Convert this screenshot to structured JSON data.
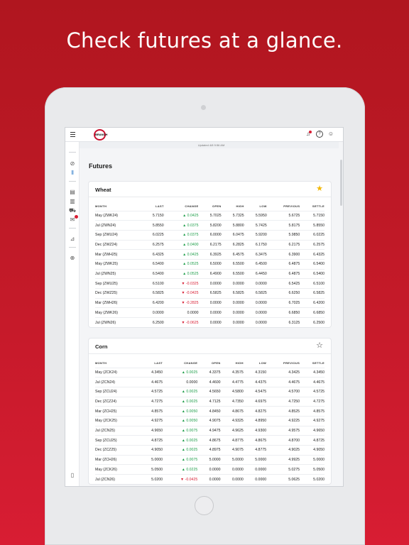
{
  "headline": "Check futures at a glance.",
  "app": {
    "logo_text": "BRANCH",
    "updated_text": "Updated 4/8 9:56 AM",
    "page_title": "Futures"
  },
  "colors": {
    "brand_red": "#c8102e",
    "up": "#1e9e4a",
    "down": "#d81d33",
    "star": "#f2b705"
  },
  "icons": {
    "menu": "hamburger-icon",
    "bell": "bell-icon",
    "help": "help-icon",
    "account": "account-icon"
  },
  "columns": [
    "MONTH",
    "LAST",
    "CHANGE",
    "OPEN",
    "HIGH",
    "LOW",
    "PREVIOUS",
    "SETTLE"
  ],
  "cards": [
    {
      "title": "Wheat",
      "starred": true,
      "rows": [
        [
          "May (ZWK24)",
          "5.7150",
          "▲ 0.0425",
          "5.7025",
          "5.7325",
          "5.5950",
          "5.6725",
          "5.7150"
        ],
        [
          "Jul (ZWN24)",
          "5.8550",
          "▲ 0.0375",
          "5.8200",
          "5.8800",
          "5.7425",
          "5.8175",
          "5.8550"
        ],
        [
          "Sep (ZWU24)",
          "6.0225",
          "▲ 0.0375",
          "6.0000",
          "6.0475",
          "5.9200",
          "5.9850",
          "6.0225"
        ],
        [
          "Dec (ZWZ24)",
          "6.2575",
          "▲ 0.0400",
          "6.2175",
          "6.2825",
          "6.1750",
          "6.2175",
          "6.2575"
        ],
        [
          "Mar (ZWH25)",
          "6.4325",
          "▲ 0.0425",
          "6.3925",
          "6.4575",
          "6.3475",
          "6.3900",
          "6.4325"
        ],
        [
          "May (ZWK25)",
          "6.5400",
          "▲ 0.0525",
          "6.5000",
          "6.5500",
          "6.4500",
          "6.4875",
          "6.5400"
        ],
        [
          "Jul (ZWN25)",
          "6.5400",
          "▲ 0.0525",
          "6.4900",
          "6.5500",
          "6.4450",
          "6.4875",
          "6.5400"
        ],
        [
          "Sep (ZWU25)",
          "6.5100",
          "▼ -0.0325",
          "0.0000",
          "0.0000",
          "0.0000",
          "6.5425",
          "6.5100"
        ],
        [
          "Dec (ZWZ25)",
          "6.5825",
          "▼ -0.0425",
          "6.5825",
          "6.5825",
          "6.5825",
          "6.6250",
          "6.5825"
        ],
        [
          "Mar (ZWH26)",
          "6.4200",
          "▼ -0.2825",
          "0.0000",
          "0.0000",
          "0.0000",
          "6.7025",
          "6.4200"
        ],
        [
          "May (ZWK26)",
          "0.0000",
          "0.0000",
          "0.0000",
          "0.0000",
          "0.0000",
          "6.6850",
          "6.6850"
        ],
        [
          "Jul (ZWN26)",
          "6.2500",
          "▼ -0.0625",
          "0.0000",
          "0.0000",
          "0.0000",
          "6.3125",
          "6.2500"
        ]
      ]
    },
    {
      "title": "Corn",
      "starred": false,
      "rows": [
        [
          "May (ZCK24)",
          "4.3450",
          "▲ 0.0025",
          "4.3375",
          "4.3575",
          "4.3150",
          "4.3425",
          "4.3450"
        ],
        [
          "Jul (ZCN24)",
          "4.4675",
          "0.0000",
          "4.4600",
          "4.4775",
          "4.4375",
          "4.4675",
          "4.4675"
        ],
        [
          "Sep (ZCU24)",
          "4.5725",
          "▲ 0.0025",
          "4.5650",
          "4.5800",
          "4.5475",
          "4.5700",
          "4.5725"
        ],
        [
          "Dec (ZCZ24)",
          "4.7275",
          "▲ 0.0025",
          "4.7125",
          "4.7350",
          "4.6975",
          "4.7250",
          "4.7275"
        ],
        [
          "Mar (ZCH25)",
          "4.8575",
          "▲ 0.0050",
          "4.8450",
          "4.8675",
          "4.8275",
          "4.8525",
          "4.8575"
        ],
        [
          "May (ZCK25)",
          "4.9275",
          "▲ 0.0050",
          "4.9075",
          "4.9325",
          "4.8950",
          "4.9225",
          "4.9275"
        ],
        [
          "Jul (ZCN25)",
          "4.9650",
          "▲ 0.0075",
          "4.9475",
          "4.9625",
          "4.9300",
          "4.9575",
          "4.9650"
        ],
        [
          "Sep (ZCU25)",
          "4.8725",
          "▲ 0.0025",
          "4.8675",
          "4.8775",
          "4.8675",
          "4.8700",
          "4.8725"
        ],
        [
          "Dec (ZCZ25)",
          "4.9050",
          "▲ 0.0025",
          "4.8975",
          "4.9075",
          "4.8775",
          "4.9025",
          "4.9050"
        ],
        [
          "Mar (ZCH26)",
          "5.0000",
          "▲ 0.0075",
          "5.0000",
          "5.0000",
          "5.0000",
          "4.9925",
          "5.0000"
        ],
        [
          "May (ZCK26)",
          "5.0500",
          "▲ 0.0225",
          "0.0000",
          "0.0000",
          "0.0000",
          "5.0275",
          "5.0500"
        ],
        [
          "Jul (ZCN26)",
          "5.0200",
          "▼ -0.0425",
          "0.0000",
          "0.0000",
          "0.0000",
          "5.0625",
          "5.0200"
        ]
      ]
    }
  ]
}
